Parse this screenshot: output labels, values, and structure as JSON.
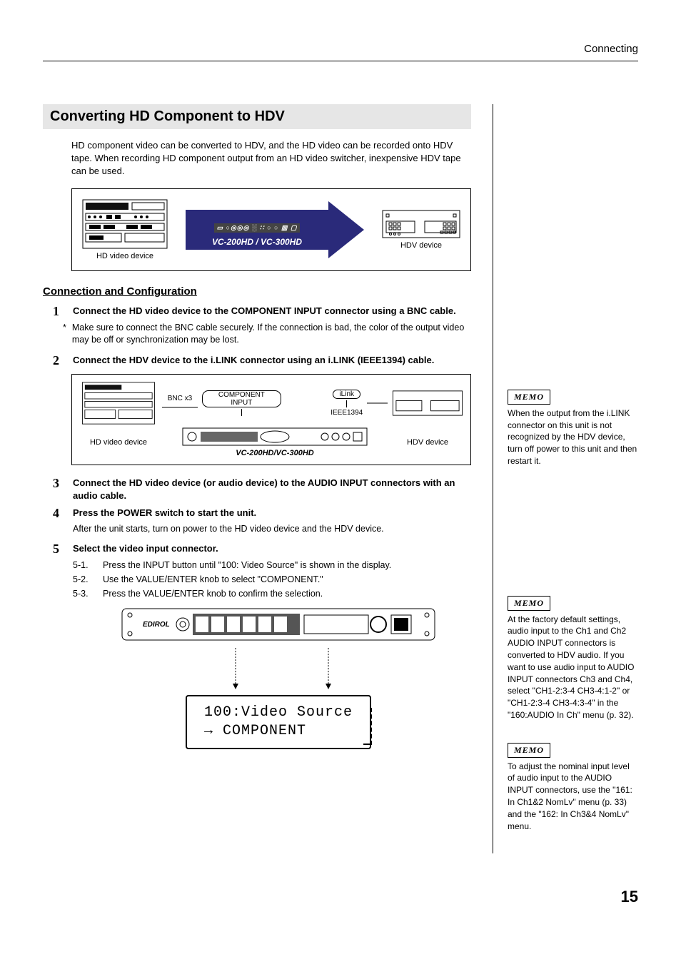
{
  "header_section": "Connecting",
  "title": "Converting HD Component to HDV",
  "intro": "HD component video can be converted to HDV, and the HD video can be recorded onto HDV tape. When recording HD component output from an HD video switcher, inexpensive HDV tape can be used.",
  "diagram1": {
    "left_label": "HD video device",
    "arrow_label": "VC-200HD / VC-300HD",
    "right_label": "HDV device"
  },
  "subhead": "Connection and Configuration",
  "steps": {
    "s1": {
      "num": "1",
      "text": "Connect the HD video device to the COMPONENT INPUT connector using a BNC cable."
    },
    "s1_note": "Make sure to connect the BNC cable securely. If the connection is bad, the color of the output video may be off or synchronization may be lost.",
    "s2": {
      "num": "2",
      "text": "Connect the HDV device to the i.LINK connector using an i.LINK (IEEE1394) cable."
    },
    "s3": {
      "num": "3",
      "text": "Connect the HD video device (or audio device) to the AUDIO INPUT connectors with an audio cable."
    },
    "s4": {
      "num": "4",
      "text": "Press the POWER switch to start the unit."
    },
    "s4_after": "After the unit starts, turn on power to the HD video device and the HDV device.",
    "s5": {
      "num": "5",
      "text": "Select the video input connector."
    },
    "s5_sub": [
      {
        "n": "5-1.",
        "t": "Press the INPUT button until \"100: Video Source\" is shown in the display."
      },
      {
        "n": "5-2.",
        "t": "Use the VALUE/ENTER knob to select \"COMPONENT.\""
      },
      {
        "n": "5-3.",
        "t": "Press the VALUE/ENTER knob to confirm the selection."
      }
    ]
  },
  "conn_diagram": {
    "left_label": "HD video device",
    "bnc": "BNC x3",
    "comp_input": "COMPONENT INPUT",
    "ilink": "iLink",
    "ieee": "IEEE1394",
    "center": "VC-200HD/VC-300HD",
    "right_label": "HDV device"
  },
  "lcd": {
    "line1": "100:Video Source",
    "line2": "  →     COMPONENT"
  },
  "memos": {
    "memo_label": "MEMO",
    "m1": "When the output from the i.LINK connector on this unit is not recognized by the HDV device, turn off power to this unit and then restart it.",
    "m2": "At the factory default settings, audio input to the Ch1 and Ch2 AUDIO INPUT connectors is converted to HDV audio. If you want to use audio input to AUDIO INPUT connectors Ch3 and Ch4, select \"CH1-2:3-4 CH3-4:1-2\" or \"CH1-2:3-4 CH3-4:3-4\" in the \"160:AUDIO In Ch\" menu (p. 32).",
    "m3": "To adjust the nominal input level of audio input to the AUDIO INPUT connectors, use the \"161: In Ch1&2 NomLv\" menu (p. 33) and the \"162: In Ch3&4 NomLv\" menu."
  },
  "page_number": "15",
  "front_panel_brand": "EDIROL"
}
